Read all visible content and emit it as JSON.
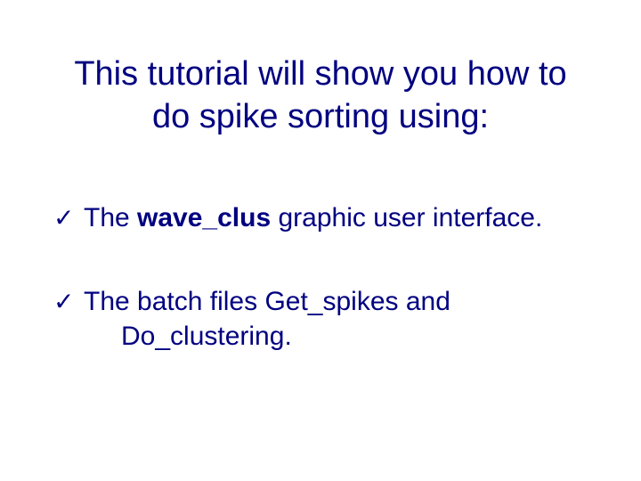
{
  "title_line1": "This tutorial will show you how to",
  "title_line2": "do spike sorting using:",
  "check": "✓",
  "b1_pre": "The ",
  "b1_bold": "wave_clus",
  "b1_post": " graphic user interface.",
  "b2_line1_pre": "The batch files ",
  "b2_line1_i1": "Get_spikes",
  "b2_line1_mid": " and",
  "b2_line2_i2": "Do_clustering",
  "b2_line2_post": "."
}
